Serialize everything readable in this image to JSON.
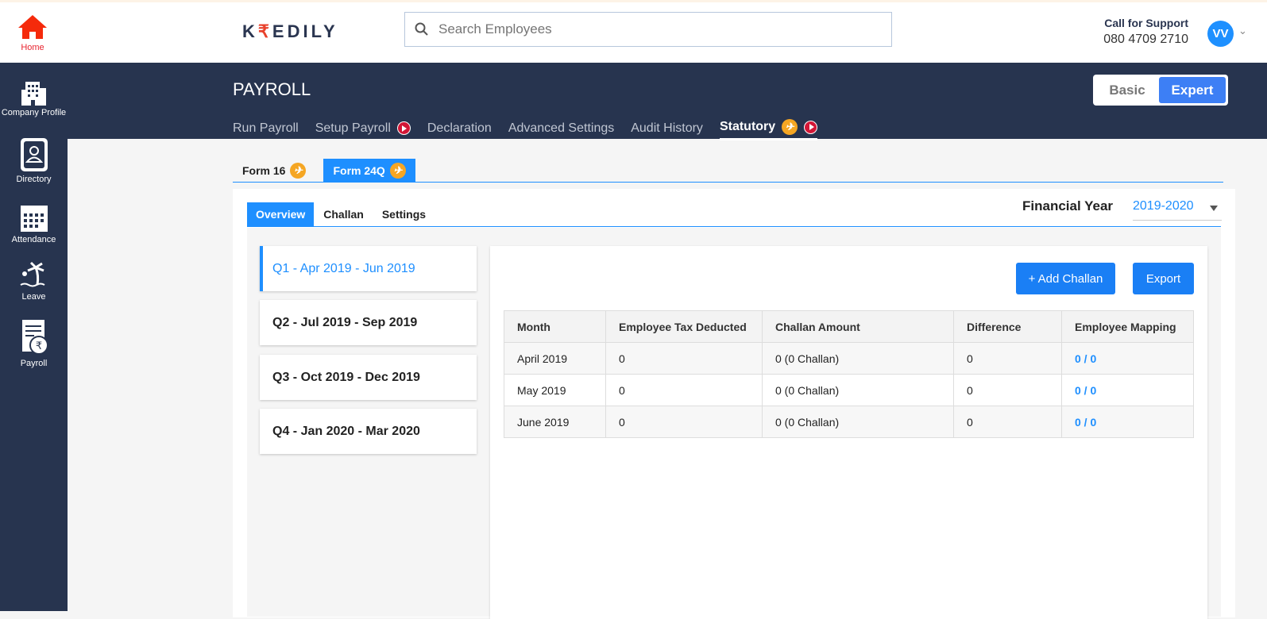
{
  "header": {
    "home_label": "Home",
    "logo_pre": "K",
    "logo_r": "₹",
    "logo_post": "EDILY",
    "search_placeholder": "Search Employees",
    "support_title": "Call for Support",
    "support_phone": "080 4709 2710",
    "avatar_initials": "VV"
  },
  "sidebar": {
    "items": [
      {
        "label": "Company Profile"
      },
      {
        "label": "Directory"
      },
      {
        "label": "Attendance"
      },
      {
        "label": "Leave"
      },
      {
        "label": "Payroll"
      }
    ]
  },
  "page": {
    "title": "PAYROLL",
    "mode_basic": "Basic",
    "mode_expert": "Expert"
  },
  "nav": {
    "tabs": [
      "Run Payroll",
      "Setup Payroll",
      "Declaration",
      "Advanced Settings",
      "Audit History",
      "Statutory"
    ]
  },
  "form_tabs": [
    "Form 16",
    "Form 24Q"
  ],
  "sub_tabs": [
    "Overview",
    "Challan",
    "Settings"
  ],
  "financial_year": {
    "label": "Financial Year",
    "value": "2019-2020"
  },
  "quarters": [
    "Q1 - Apr 2019 - Jun 2019",
    "Q2 - Jul 2019 - Sep 2019",
    "Q3 - Oct 2019 - Dec 2019",
    "Q4 - Jan 2020 - Mar 2020"
  ],
  "actions": {
    "add_challan": "+ Add Challan",
    "export": "Export"
  },
  "table": {
    "headers": [
      "Month",
      "Employee Tax Deducted",
      "Challan Amount",
      "Difference",
      "Employee Mapping"
    ],
    "rows": [
      [
        "April 2019",
        "0",
        "0 (0 Challan)",
        "0",
        "0 / 0"
      ],
      [
        "May 2019",
        "0",
        "0 (0 Challan)",
        "0",
        "0 / 0"
      ],
      [
        "June 2019",
        "0",
        "0 (0 Challan)",
        "0",
        "0 / 0"
      ]
    ]
  }
}
